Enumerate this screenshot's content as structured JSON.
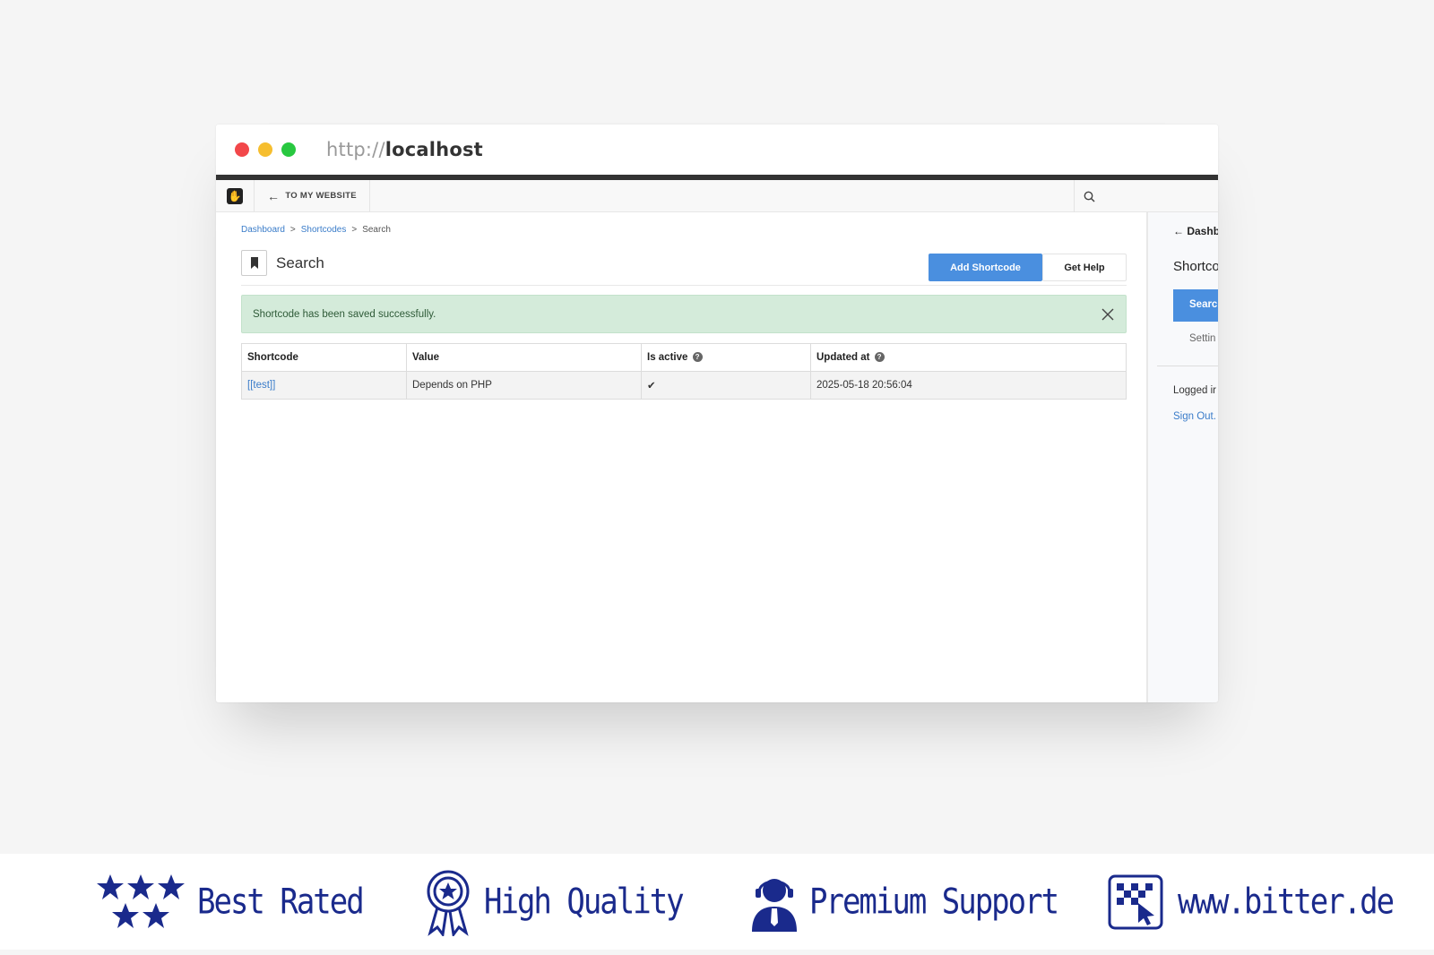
{
  "browser": {
    "url_protocol": "http://",
    "url_host": "localhost"
  },
  "toolbar": {
    "back_label": "TO MY WEBSITE"
  },
  "breadcrumb": {
    "items": [
      "Dashboard",
      "Shortcodes",
      "Search"
    ],
    "separator": ">"
  },
  "page": {
    "title": "Search",
    "add_button": "Add Shortcode",
    "help_button": "Get Help"
  },
  "alert": {
    "message": "Shortcode has been saved successfully."
  },
  "table": {
    "headers": [
      "Shortcode",
      "Value",
      "Is active",
      "Updated at"
    ],
    "rows": [
      {
        "shortcode": "[[test]]",
        "value": "Depends on PHP",
        "is_active": "✔",
        "updated_at": "2025-05-18 20:56:04"
      }
    ]
  },
  "sidebar": {
    "back_label": "Dashb",
    "section_title": "Shortco",
    "active_item": "Searc",
    "settings_item": "Settin",
    "logged_in_text": "Logged ir",
    "sign_out": "Sign Out."
  },
  "footer": {
    "badges": [
      {
        "icon": "stars-icon",
        "label": "Best Rated"
      },
      {
        "icon": "award-ribbon-icon",
        "label": "High Quality"
      },
      {
        "icon": "support-agent-icon",
        "label": "Premium Support"
      },
      {
        "icon": "bitter-logo-icon",
        "label": "www.bitter.de"
      }
    ]
  },
  "colors": {
    "accent_blue": "#4a8fdf",
    "alert_green": "#d4ebda",
    "footer_navy": "#1a2a8c"
  }
}
